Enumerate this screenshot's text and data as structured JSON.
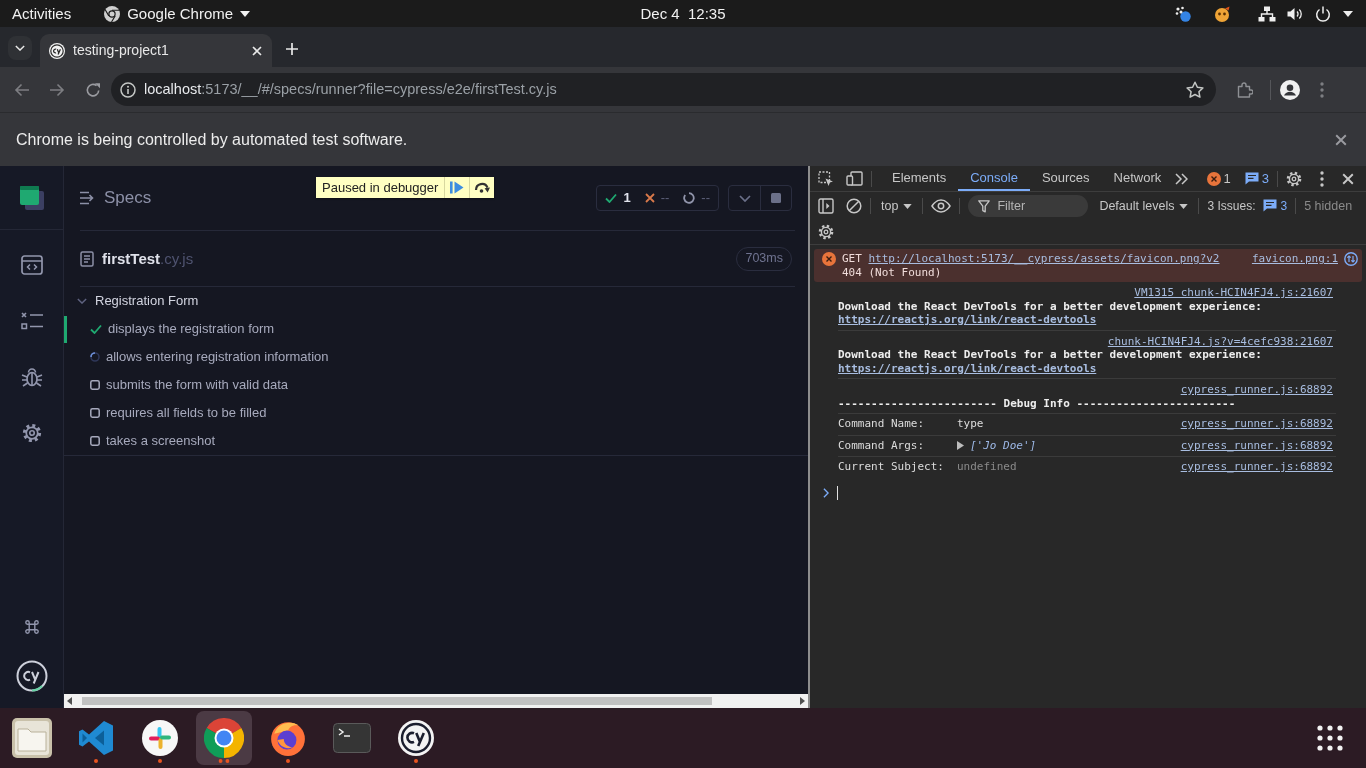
{
  "top_bar": {
    "activities": "Activities",
    "app_menu": "Google Chrome",
    "clock": "Dec 4  12:35"
  },
  "browser": {
    "tabs": [
      {
        "title": "testing-project1",
        "selected": true
      }
    ],
    "url_host": "localhost",
    "url_path": ":5173/__/#/specs/runner?file=cypress/e2e/firstTest.cy.js",
    "infobar": "Chrome is being controlled by automated test software."
  },
  "runner": {
    "header": "Specs",
    "debugger_banner": "Paused in debugger",
    "stats": [
      {
        "kind": "passed",
        "count": "1"
      },
      {
        "kind": "failed",
        "count": "--"
      },
      {
        "kind": "pending",
        "count": "--"
      }
    ],
    "spec": {
      "name": "firstTest",
      "extension": ".cy.js",
      "duration": "703ms"
    },
    "suite": {
      "title": "Registration Form",
      "expanded": true,
      "tests": [
        {
          "title": "displays the registration form",
          "kind": "passed"
        },
        {
          "title": "allows entering registration information",
          "kind": "running"
        },
        {
          "title": "submits the form with valid data",
          "kind": "pending"
        },
        {
          "title": "requires all fields to be filled",
          "kind": "pending"
        },
        {
          "title": "takes a screenshot",
          "kind": "pending"
        }
      ]
    }
  },
  "devtools": {
    "tabs": [
      {
        "label": "Elements",
        "selected": false
      },
      {
        "label": "Console",
        "selected": true
      },
      {
        "label": "Sources",
        "selected": false
      },
      {
        "label": "Network",
        "selected": false
      }
    ],
    "error_count": "1",
    "message_count": "3",
    "context": "top",
    "filter_placeholder": "Filter",
    "levels": "Default levels",
    "issues_label": "3 Issues:",
    "issues_count": "3",
    "hidden": "5 hidden",
    "console": [
      {
        "kind": "error",
        "method": "GET",
        "url": "http://localhost:5173/__cypress/assets/favicon.png?v2",
        "status": "404 (Not Found)",
        "source": "favicon.png:1"
      },
      {
        "kind": "log",
        "source": "VM1315 chunk-HCIN4FJ4.js:21607",
        "text": "Download the React DevTools for a better development experience:",
        "link": "https://reactjs.org/link/react-devtools"
      },
      {
        "kind": "log",
        "source": "chunk-HCIN4FJ4.js?v=4cefc938:21607",
        "text": "Download the React DevTools for a better development experience:",
        "link": "https://reactjs.org/link/react-devtools"
      },
      {
        "kind": "heading",
        "source": "cypress_runner.js:68892",
        "text": "------------------------ Debug Info ------------------------"
      },
      {
        "kind": "field",
        "label": "Command Name:",
        "value": "type",
        "source": "cypress_runner.js:68892"
      },
      {
        "kind": "array_field",
        "label": "Command Args:",
        "value": "['Jo Doe']",
        "source": "cypress_runner.js:68892"
      },
      {
        "kind": "undefined_field",
        "label": "Current Subject:",
        "value": "undefined",
        "source": "cypress_runner.js:68892"
      }
    ]
  },
  "dock": [
    {
      "kind": "files",
      "selected": false,
      "running": false,
      "several_windows": false
    },
    {
      "kind": "editor",
      "selected": false,
      "running": true,
      "several_windows": false
    },
    {
      "kind": "chat",
      "selected": false,
      "running": true,
      "several_windows": false
    },
    {
      "kind": "browser",
      "selected": true,
      "running": true,
      "several_windows": true
    },
    {
      "kind": "fox_browser",
      "selected": false,
      "running": true,
      "several_windows": false
    },
    {
      "kind": "terminal",
      "selected": false,
      "running": false,
      "several_windows": false
    },
    {
      "kind": "test_runner",
      "selected": false,
      "running": true,
      "several_windows": false
    }
  ]
}
